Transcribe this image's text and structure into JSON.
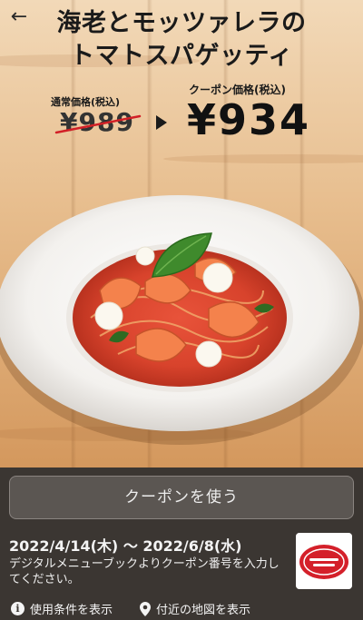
{
  "nav": {
    "back_icon": "arrow-left-icon",
    "back_glyph": "←"
  },
  "coupon": {
    "title_line1": "海老とモッツァレラの",
    "title_line2": "トマトスパゲッティ",
    "regular_label": "通常価格(税込)",
    "regular_price": "¥989",
    "coupon_label": "クーポン価格(税込)",
    "coupon_price": "¥934"
  },
  "panel": {
    "use_button": "クーポンを使う",
    "date_range": "2022/4/14(木) 〜 2022/6/8(水)",
    "instruction": "デジタルメニューブックよりクーポン番号を入力してください。",
    "terms_link": "使用条件を表示",
    "map_link": "付近の地図を表示",
    "info_icon_glyph": "i"
  },
  "colors": {
    "panel_bg": "#3b3632",
    "button_bg": "#5b5652",
    "logo_red": "#d4202a"
  }
}
